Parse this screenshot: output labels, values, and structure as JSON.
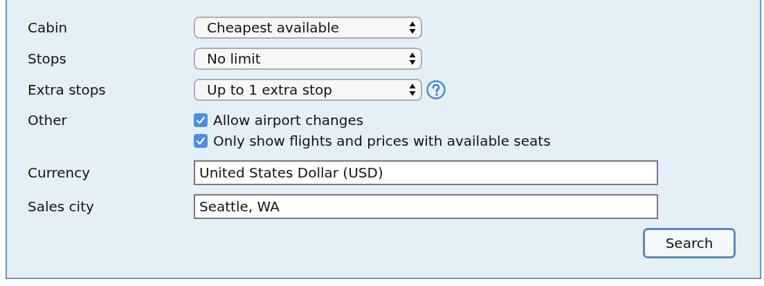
{
  "rows": [
    {
      "kind": "select",
      "label": "Cabin",
      "value": "Cheapest available",
      "help": false
    },
    {
      "kind": "select",
      "label": "Stops",
      "value": "No limit",
      "help": false
    },
    {
      "kind": "select",
      "label": "Extra stops",
      "value": "Up to 1 extra stop",
      "help": true
    },
    {
      "kind": "checkboxes",
      "label": "Other",
      "options": [
        {
          "label": "Allow airport changes",
          "checked": true
        },
        {
          "label": "Only show flights and prices with available seats",
          "checked": true
        }
      ]
    },
    {
      "kind": "text",
      "label": "Currency",
      "value": "United States Dollar (USD)"
    },
    {
      "kind": "text",
      "label": "Sales city",
      "value": "Seattle, WA"
    }
  ],
  "search_button": "Search"
}
